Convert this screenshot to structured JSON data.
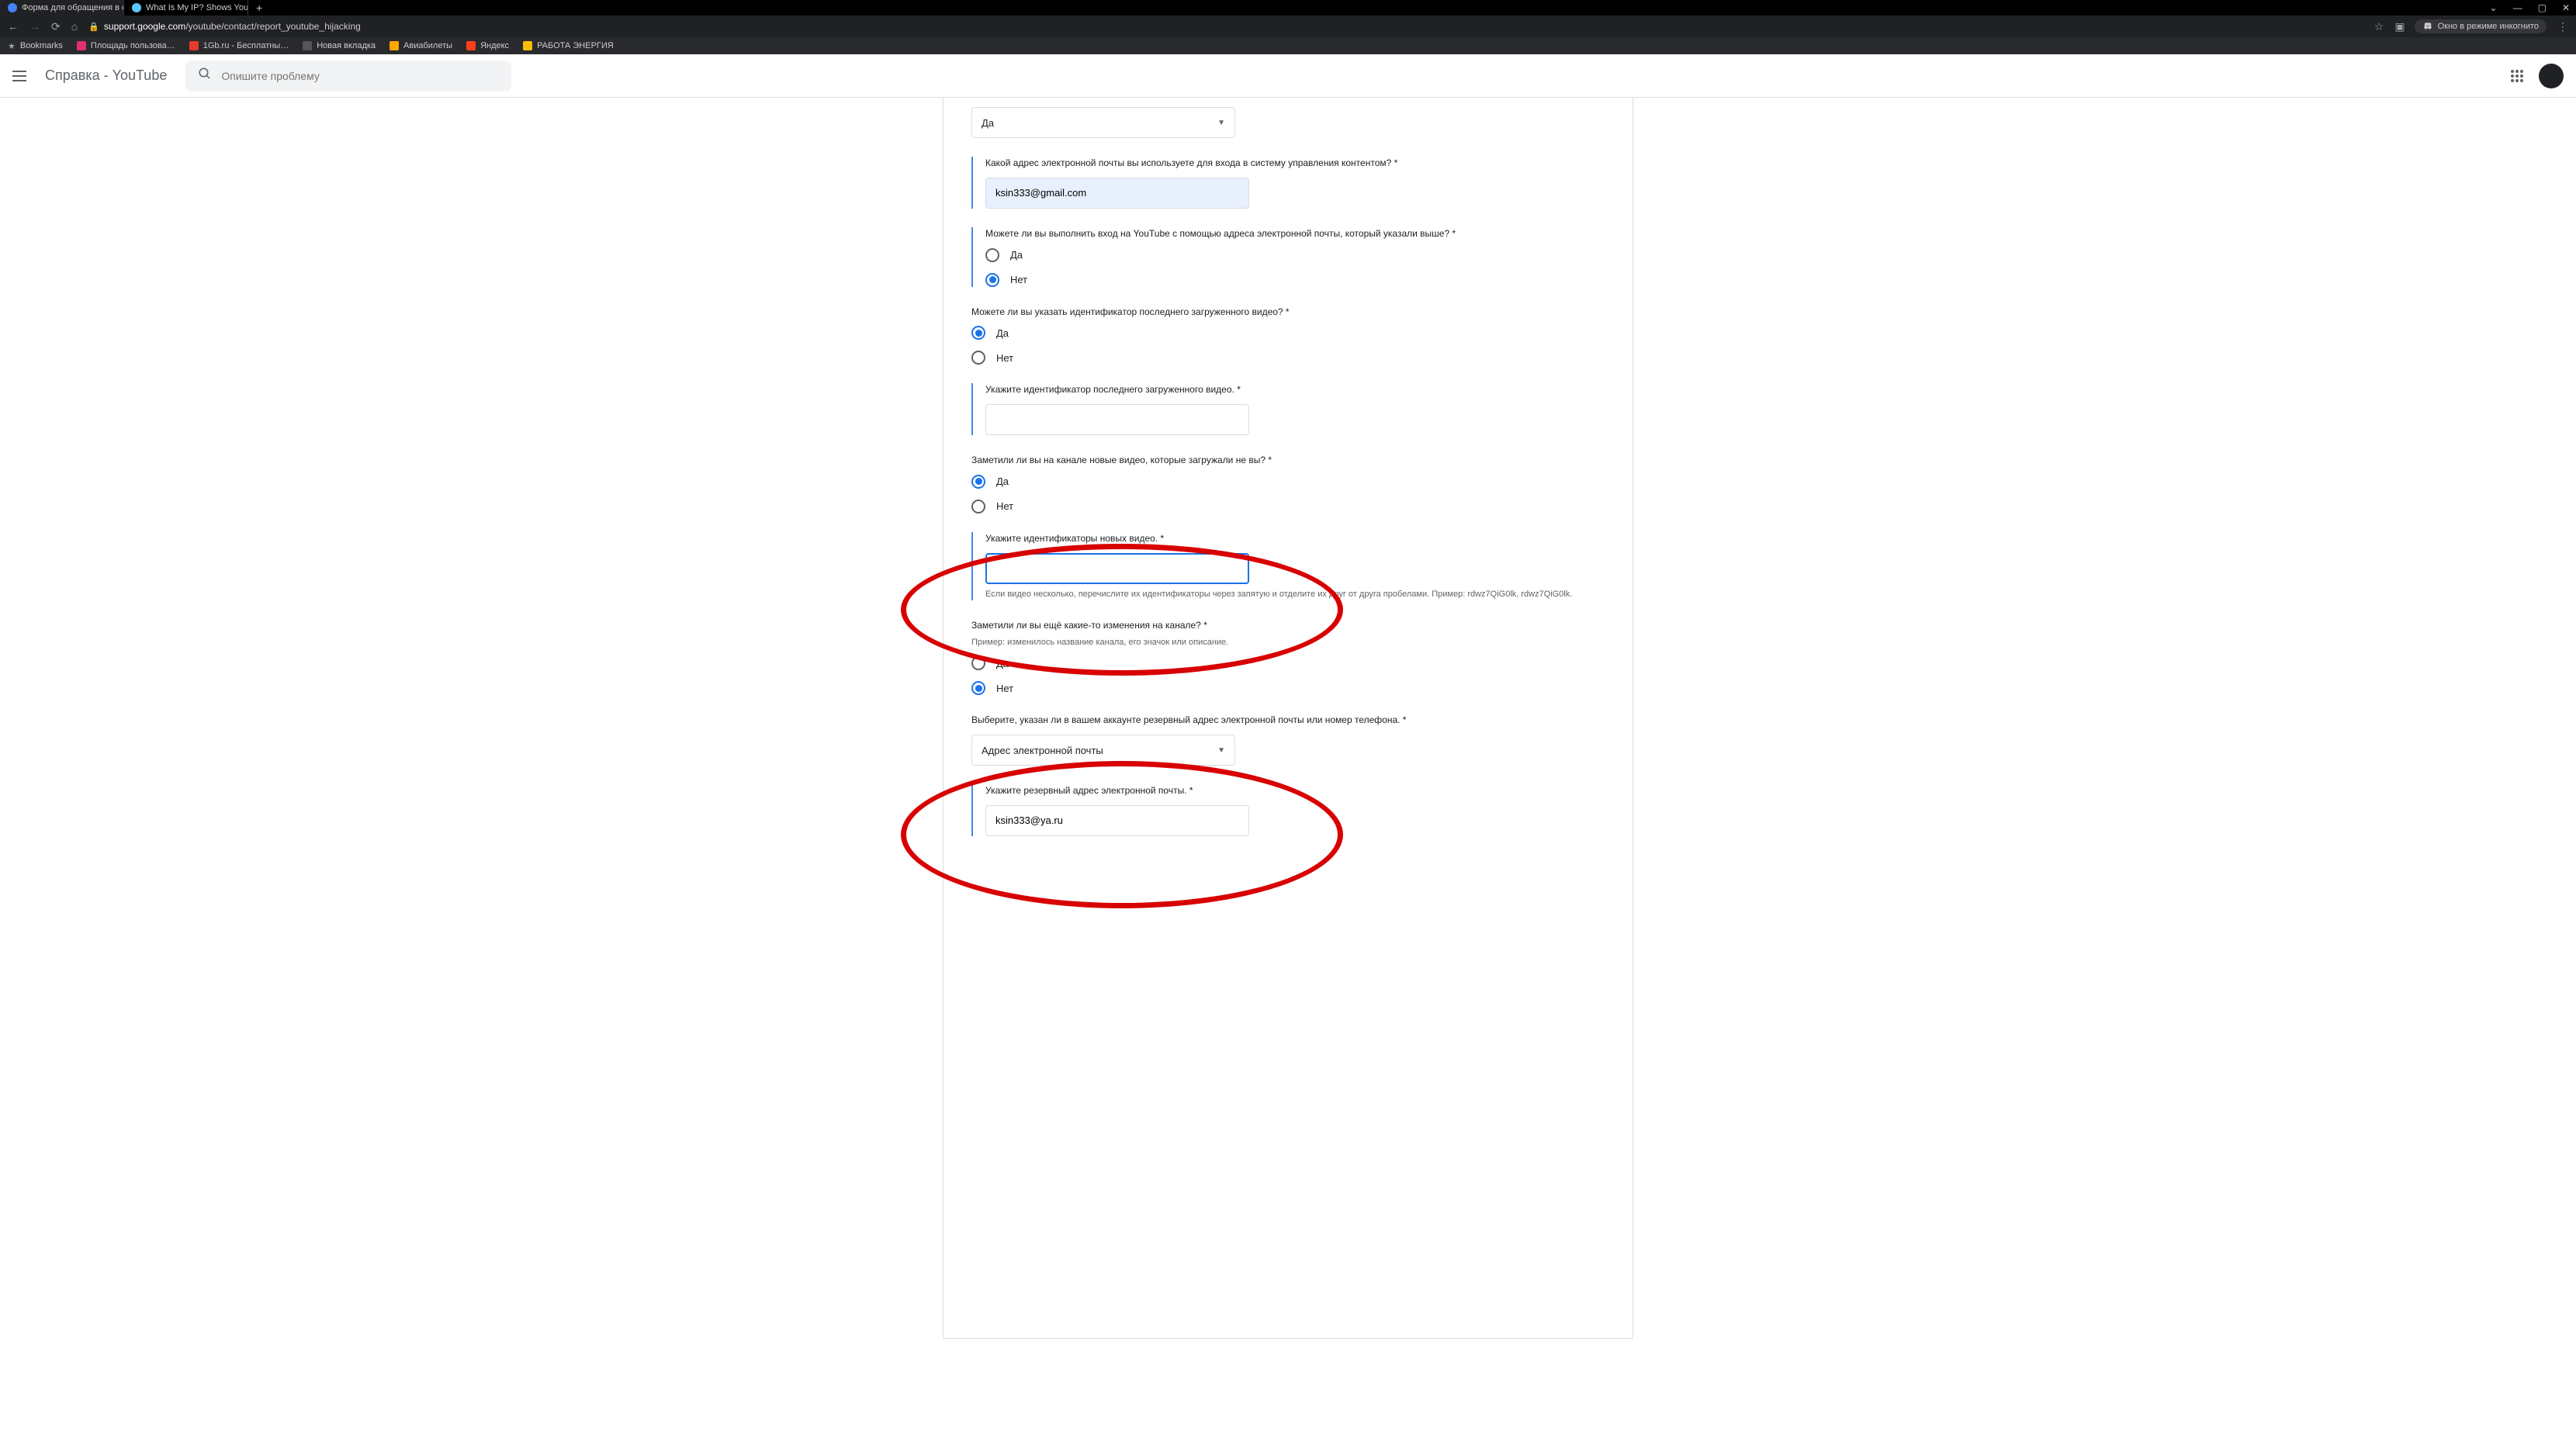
{
  "browser": {
    "tabs": [
      {
        "title": "Форма для обращения в служб…",
        "active": true
      },
      {
        "title": "What Is My IP? Shows Your Publ…",
        "active": false
      }
    ],
    "window_controls": {
      "min": "—",
      "max": "▢",
      "close": "✕",
      "dropdown": "⌄"
    },
    "url_domain": "support.google.com",
    "url_path": "/youtube/contact/report_youtube_hijacking",
    "incognito_label": "Окно в режиме инкогнито",
    "bookmarks": [
      {
        "label": "Bookmarks",
        "color": ""
      },
      {
        "label": "Площадь пользова…",
        "color": "#e1306c"
      },
      {
        "label": "1Gb.ru - Бесплатны…",
        "color": "#e43b2c"
      },
      {
        "label": "Новая вкладка",
        "color": "#555"
      },
      {
        "label": "Авиабилеты",
        "color": "#ffa500"
      },
      {
        "label": "Яндекс",
        "color": "#fc3f1d"
      },
      {
        "label": "РАБОТА ЭНЕРГИЯ",
        "color": "#fbbc04"
      }
    ]
  },
  "header": {
    "app_title": "Справка - YouTube",
    "search_placeholder": "Опишите проблему"
  },
  "form": {
    "select1_value": "Да",
    "q_email_label": "Какой адрес электронной почты вы используете для входа в систему управления контентом? *",
    "q_email_value": "ksin333@gmail.com",
    "q_login_label": "Можете ли вы выполнить вход на YouTube с помощью адреса электронной почты, который указали выше? *",
    "opt_yes": "Да",
    "opt_no": "Нет",
    "q_lastvideo_label": "Можете ли вы указать идентификатор последнего загруженного видео? *",
    "q_lastvideo_id_label": "Укажите идентификатор последнего загруженного видео. *",
    "q_newvideos_label": "Заметили ли вы на канале новые видео, которые загружали не вы? *",
    "q_newvideos_id_label": "Укажите идентификаторы новых видео. *",
    "q_newvideos_helper": "Если видео несколько, перечислите их идентификаторы через запятую и отделите их друг от друга пробелами. Пример: rdwz7QiG0lk, rdwz7QiG0lk.",
    "q_other_changes_label": "Заметили ли вы ещё какие-то изменения на канале? *",
    "q_other_changes_helper": "Пример: изменилось название канала, его значок или описание.",
    "q_backup_label": "Выберите, указан ли в вашем аккаунте резервный адрес электронной почты или номер телефона. *",
    "q_backup_value": "Адрес электронной почты",
    "q_backup_email_label": "Укажите резервный адрес электронной почты. *",
    "q_backup_email_value": "ksin333@ya.ru"
  }
}
